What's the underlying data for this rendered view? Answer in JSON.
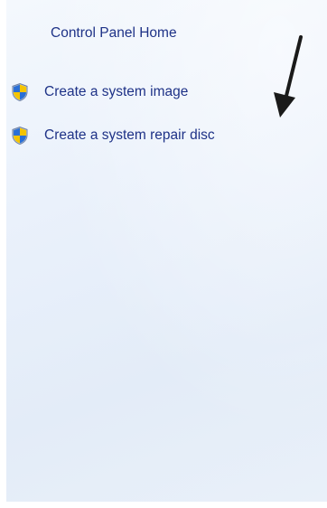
{
  "sidebar": {
    "home_link": "Control Panel Home",
    "tasks": [
      {
        "label": "Create a system image",
        "icon": "uac-shield-icon"
      },
      {
        "label": "Create a system repair disc",
        "icon": "uac-shield-icon"
      }
    ]
  },
  "colors": {
    "link": "#1e3287",
    "pane_background": "#e6eef9",
    "shield_blue": "#2a6fd6",
    "shield_yellow": "#f5c400"
  }
}
